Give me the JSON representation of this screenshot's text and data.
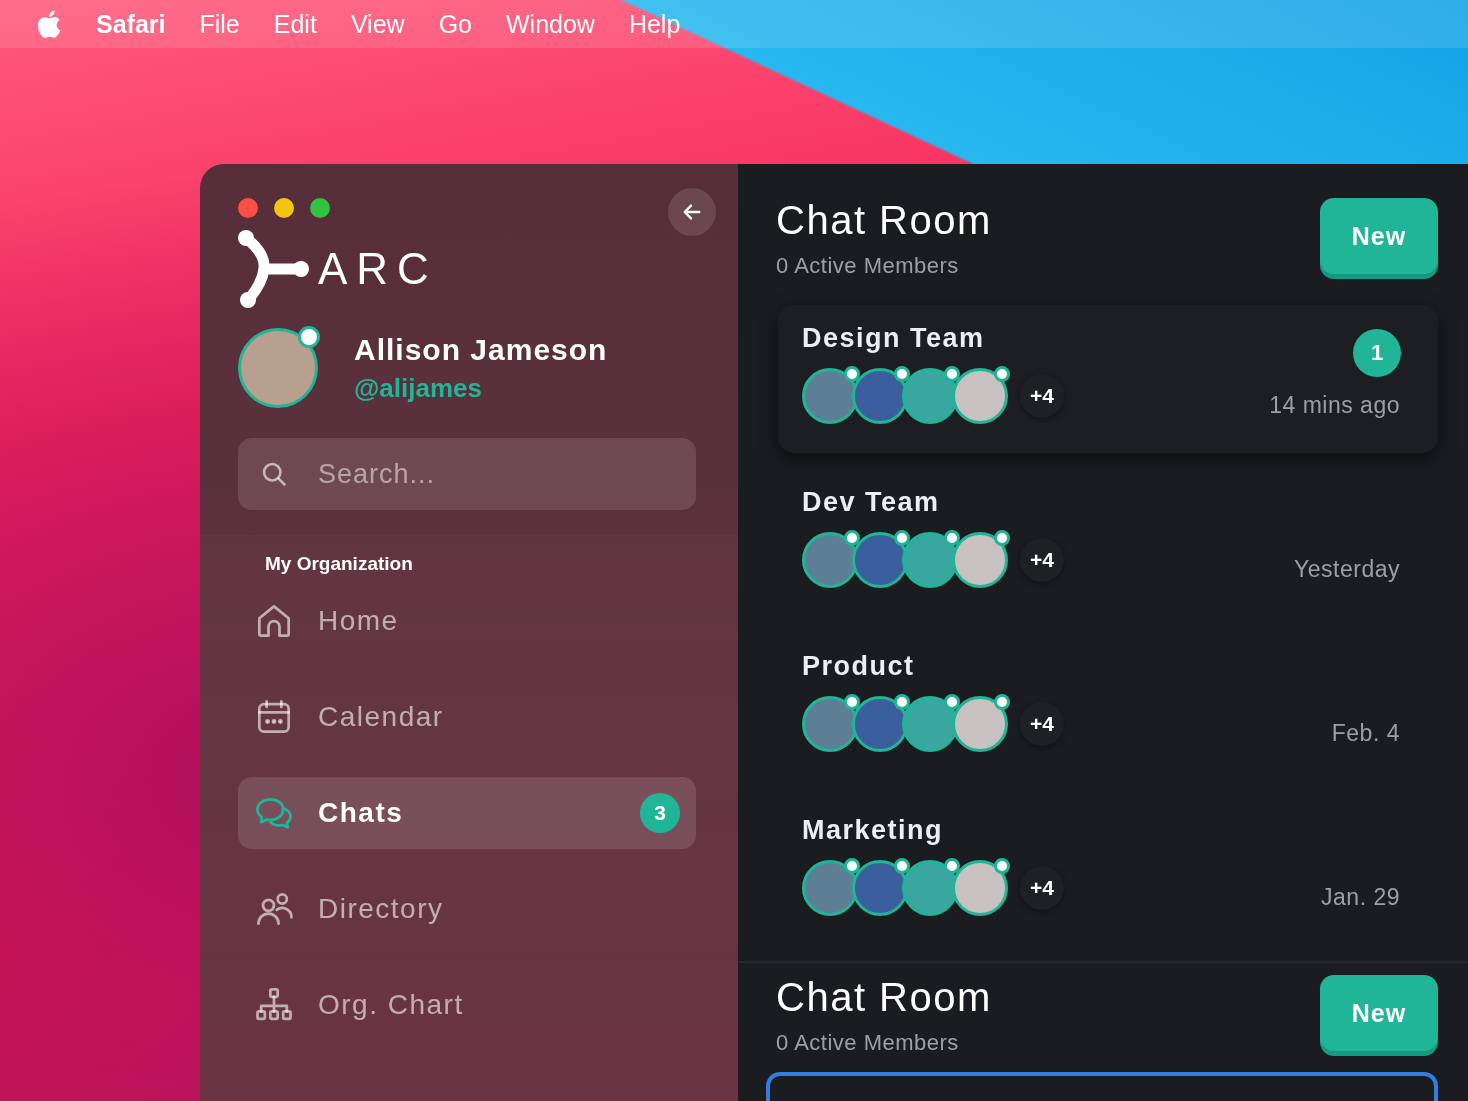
{
  "menu_bar": {
    "app_name": "Safari",
    "menus": [
      "File",
      "Edit",
      "View",
      "Go",
      "Window",
      "Help"
    ]
  },
  "sidebar": {
    "logo_text": "ARC",
    "user": {
      "name": "Allison Jameson",
      "handle": "@alijames",
      "online": true
    },
    "search": {
      "placeholder": "Search..."
    },
    "section_title": "My Organization",
    "nav": [
      {
        "kind": "home",
        "label": "Home",
        "selected": false
      },
      {
        "kind": "calendar",
        "label": "Calendar",
        "selected": false
      },
      {
        "kind": "chats",
        "label": "Chats",
        "selected": true,
        "badge": "3"
      },
      {
        "kind": "directory",
        "label": "Directory",
        "selected": false
      },
      {
        "kind": "org-chart",
        "label": "Org. Chart",
        "selected": false
      }
    ]
  },
  "panels": [
    {
      "title": "Chat Room",
      "subtitle": "0 Active Members",
      "button": "New",
      "chats": [
        {
          "name": "Design Team",
          "selected": true,
          "unread": "1",
          "extra": "+4",
          "time": "14 mins ago",
          "members": [
            {
              "online": true
            },
            {
              "online": true
            },
            {
              "online": true
            },
            {
              "online": true
            }
          ]
        },
        {
          "name": "Dev Team",
          "selected": false,
          "extra": "+4",
          "time": "Yesterday",
          "members": [
            {
              "online": true
            },
            {
              "online": true
            },
            {
              "online": true
            },
            {
              "online": true
            }
          ]
        },
        {
          "name": "Product",
          "selected": false,
          "extra": "+4",
          "time": "Feb. 4",
          "members": [
            {
              "online": true
            },
            {
              "online": true
            },
            {
              "online": true
            },
            {
              "online": true
            }
          ]
        },
        {
          "name": "Marketing",
          "selected": false,
          "extra": "+4",
          "time": "Jan. 29",
          "members": [
            {
              "online": true
            },
            {
              "online": true
            },
            {
              "online": true
            },
            {
              "online": true
            }
          ]
        }
      ]
    },
    {
      "title": "Chat Room",
      "subtitle": "0 Active Members",
      "button": "New"
    }
  ]
}
